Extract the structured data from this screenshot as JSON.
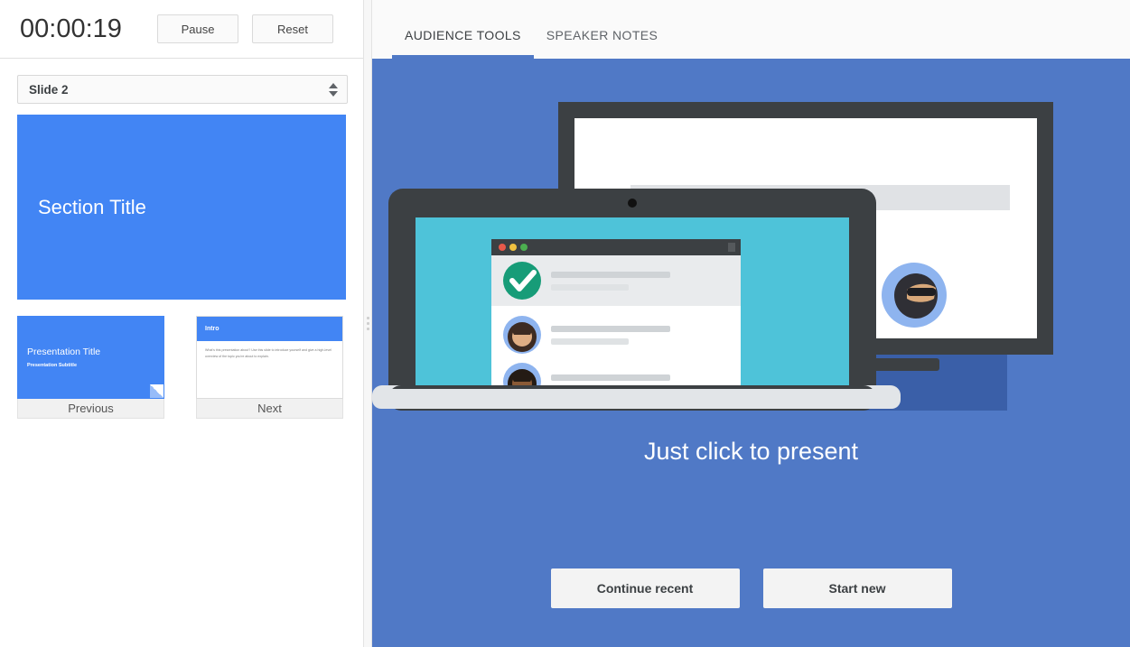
{
  "timer": {
    "value": "00:00:19",
    "pause_label": "Pause",
    "reset_label": "Reset"
  },
  "slide_selector": {
    "value": "Slide 2"
  },
  "current_slide": {
    "title": "Section Title",
    "background_color": "#4285f4",
    "text_color": "#ffffff"
  },
  "thumbnails": {
    "previous": {
      "nav_label": "Previous",
      "title": "Presentation Title",
      "subtitle": "Presentation Subtitle"
    },
    "next": {
      "nav_label": "Next",
      "heading": "Intro",
      "body": "What's this presentation about? Use this slide to introduce yourself and give a high-level overview of the topic you're about to explain."
    }
  },
  "tabs": [
    {
      "label": "AUDIENCE TOOLS",
      "active": true
    },
    {
      "label": "SPEAKER NOTES",
      "active": false
    }
  ],
  "stage": {
    "headline": "Just click to present",
    "continue_label": "Continue recent",
    "start_label": "Start new",
    "background_color": "#5079c6",
    "accent_dark_blue": "#3a5fa8",
    "laptop_screen_color": "#4ec3d9",
    "check_color": "#179c78"
  }
}
